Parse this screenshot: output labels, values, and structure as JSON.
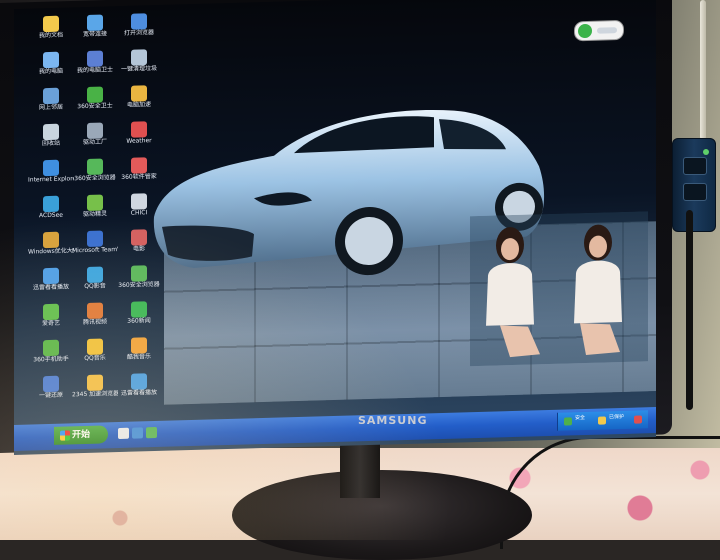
{
  "photo": {
    "monitor_brand": "SAMSUNG"
  },
  "desktop": {
    "icons": [
      {
        "label": "我的文档",
        "color": "#f2c94c"
      },
      {
        "label": "宽带连接",
        "color": "#5aa6e8"
      },
      {
        "label": "打开浏览器",
        "color": "#4e8ee0"
      },
      {
        "label": "我的电脑",
        "color": "#7bb6f0"
      },
      {
        "label": "我的电脑卫士",
        "color": "#5c7fd4"
      },
      {
        "label": "一键清理垃圾",
        "color": "#b4c6d8"
      },
      {
        "label": "网上邻居",
        "color": "#6aa0d8"
      },
      {
        "label": "360安全卫士",
        "color": "#49b246"
      },
      {
        "label": "电脑加速",
        "color": "#e9b541"
      },
      {
        "label": "回收站",
        "color": "#c8d4de"
      },
      {
        "label": "驱动工厂",
        "color": "#9aa8b8"
      },
      {
        "label": "Weather",
        "color": "#e05050"
      },
      {
        "label": "Internet Explorer",
        "color": "#3f8fe0"
      },
      {
        "label": "360安全浏览器",
        "color": "#56b85a"
      },
      {
        "label": "360软件管家",
        "color": "#e25a5a"
      },
      {
        "label": "ACDSee",
        "color": "#3aa0d8"
      },
      {
        "label": "驱动精灵",
        "color": "#77c04a"
      },
      {
        "label": "CHICI",
        "color": "#cfd6e0"
      },
      {
        "label": "Windows优化大师",
        "color": "#d8a23c"
      },
      {
        "label": "Microsoft TeamViewer",
        "color": "#3a70d0"
      },
      {
        "label": "电影",
        "color": "#d46060"
      },
      {
        "label": "迅雷看看播放",
        "color": "#4f9fe8"
      },
      {
        "label": "QQ影音",
        "color": "#3da6e0"
      },
      {
        "label": "360安全浏览器",
        "color": "#5bb95d"
      },
      {
        "label": "爱奇艺",
        "color": "#61c04f"
      },
      {
        "label": "腾讯视频",
        "color": "#e07a3a"
      },
      {
        "label": "360新闻",
        "color": "#3ab857"
      },
      {
        "label": "360手机助手",
        "color": "#5ab84b"
      },
      {
        "label": "QQ音乐",
        "color": "#f0c23c"
      },
      {
        "label": "酷我音乐",
        "color": "#f0a33c"
      },
      {
        "label": "一键还原",
        "color": "#4c7ed8"
      },
      {
        "label": "2345 加速浏览器",
        "color": "#f2c04a"
      },
      {
        "label": "迅雷看看播放",
        "color": "#49a0e6"
      }
    ],
    "widget_color": "#3bb34a"
  },
  "taskbar": {
    "start_label": "开始",
    "tray_labels": [
      "安全",
      "已保护"
    ]
  },
  "colors": {
    "taskbar": "#235ec9",
    "start": "#2e8c2a"
  }
}
